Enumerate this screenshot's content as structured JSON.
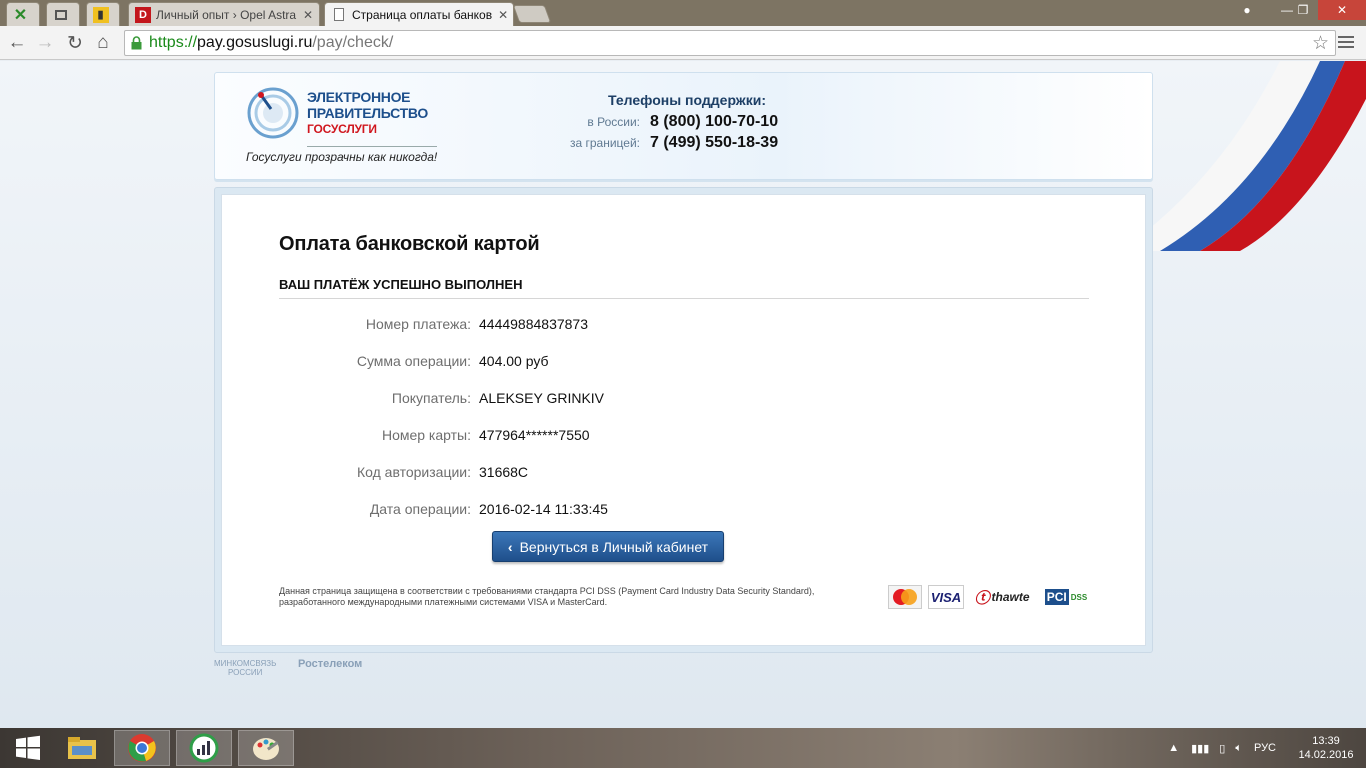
{
  "browser": {
    "tabs": [
      {
        "label": "",
        "icon": "x-app-icon"
      },
      {
        "label": "",
        "icon": "window-icon"
      },
      {
        "label": "",
        "icon": "chart-app-icon"
      },
      {
        "label": "Личный опыт › Opel Astra",
        "icon": "drive2-d-icon"
      },
      {
        "label": "Страница оплаты банков",
        "icon": "page-icon",
        "active": true
      }
    ],
    "url": {
      "scheme": "https://",
      "host": "pay.gosuslugi.ru",
      "path": "/pay/check/"
    }
  },
  "header": {
    "logo_line1": "ЭЛЕКТРОННОЕ",
    "logo_line2": "ПРАВИТЕЛЬСТВО",
    "logo_line3": "ГОСУСЛУГИ",
    "slogan": "Госуслуги прозрачны как никогда!",
    "support_title": "Телефоны поддержки:",
    "support": [
      {
        "label": "в России:",
        "number": "8 (800) 100-70-10"
      },
      {
        "label": "за границей:",
        "number": "7 (499) 550-18-39"
      }
    ]
  },
  "payment": {
    "title": "Оплата банковской картой",
    "status": "ВАШ ПЛАТЁЖ УСПЕШНО ВЫПОЛНЕН",
    "fields": [
      {
        "key": "Номер платежа:",
        "value": "44449884837873"
      },
      {
        "key": "Сумма операции:",
        "value": "404.00 руб"
      },
      {
        "key": "Покупатель:",
        "value": "ALEKSEY GRINKIV"
      },
      {
        "key": "Номер карты:",
        "value": "477964******7550"
      },
      {
        "key": "Код авторизации:",
        "value": "31668C"
      },
      {
        "key": "Дата операции:",
        "value": "2016-02-14 11:33:45"
      }
    ],
    "back_button": "Вернуться в Личный кабинет",
    "pci_note": "Данная страница защищена в соответствии с требованиями стандарта PCI DSS (Payment Card Industry Data Security Standard), разработанного международными платежными системами VISA и MasterCard.",
    "badges": {
      "mastercard": "MasterCard",
      "visa": "VISA",
      "thawte": "thawte",
      "pci": "PCI",
      "dss": "DSS"
    }
  },
  "footer": {
    "minkom1": "МИНКОМСВЯЗЬ",
    "minkom2": "РОССИИ",
    "rostelecom": "Ростелеком"
  },
  "taskbar": {
    "lang": "РУС",
    "time": "13:39",
    "date": "14.02.2016"
  },
  "colors": {
    "brand_blue": "#1d4f8c",
    "brand_red": "#d0171f",
    "button": "#2a5f9e",
    "https_green": "#1a8a1a"
  }
}
